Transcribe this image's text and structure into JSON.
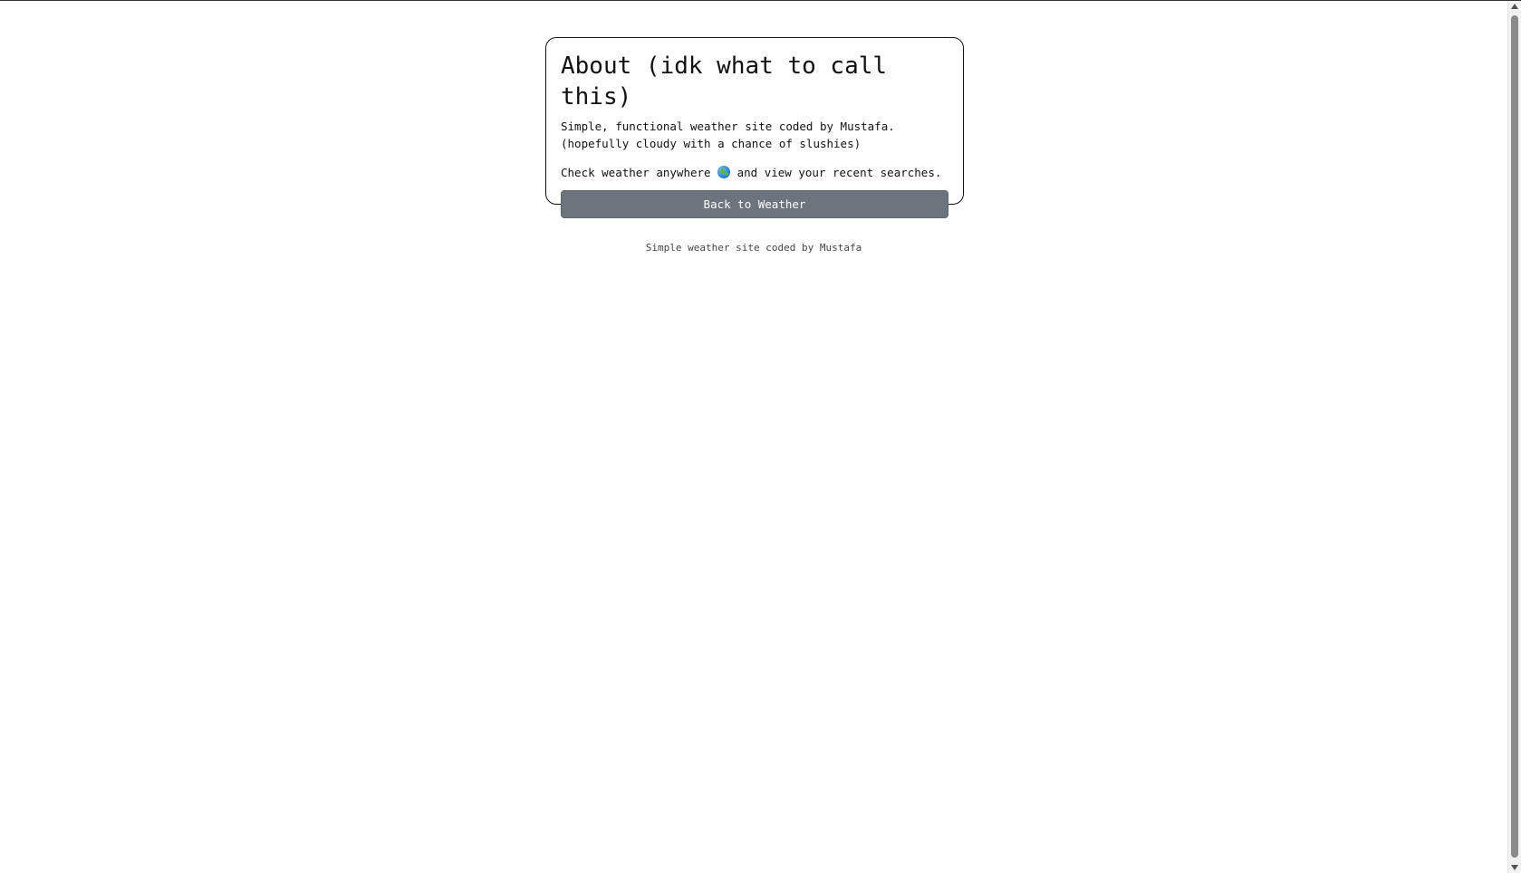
{
  "about": {
    "title": "About (idk what to call this)",
    "description": "Simple, functional weather site coded by Mustafa. (hopefully cloudy with a chance of slushies)",
    "check_before": "Check weather anywhere ",
    "check_icon": "globe-icon",
    "check_after": " and view your recent searches.",
    "back_button": "Back to Weather"
  },
  "footer": {
    "text": "Simple weather site coded by Mustafa"
  },
  "colors": {
    "button_bg": "#6c757d",
    "button_text": "#ffffff",
    "card_border": "#111111"
  }
}
